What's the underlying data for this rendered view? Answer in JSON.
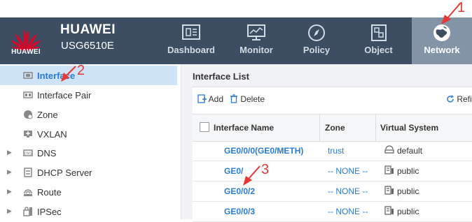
{
  "brand": {
    "logo_text": "HUAWEI",
    "name": "HUAWEI",
    "model": "USG6510E"
  },
  "nav": [
    {
      "label": "Dashboard",
      "icon": "dashboard-icon"
    },
    {
      "label": "Monitor",
      "icon": "monitor-icon"
    },
    {
      "label": "Policy",
      "icon": "policy-compass-icon"
    },
    {
      "label": "Object",
      "icon": "object-icon"
    },
    {
      "label": "Network",
      "icon": "network-globe-icon",
      "active": true
    }
  ],
  "sidebar": {
    "items": [
      {
        "label": "Interface",
        "icon": "interface-icon",
        "active": true
      },
      {
        "label": "Interface Pair",
        "icon": "interface-pair-icon"
      },
      {
        "label": "Zone",
        "icon": "zone-icon"
      },
      {
        "label": "VXLAN",
        "icon": "vxlan-icon"
      },
      {
        "label": "DNS",
        "icon": "dns-icon",
        "expandable": true
      },
      {
        "label": "DHCP Server",
        "icon": "dhcp-server-icon",
        "expandable": true
      },
      {
        "label": "Route",
        "icon": "route-icon",
        "expandable": true
      },
      {
        "label": "IPSec",
        "icon": "ipsec-icon",
        "expandable": true
      }
    ]
  },
  "main": {
    "title": "Interface List",
    "toolbar": {
      "add_label": "Add",
      "delete_label": "Delete",
      "refresh_label": "Refi"
    },
    "table": {
      "headers": {
        "name": "Interface Name",
        "zone": "Zone",
        "vsys": "Virtual System"
      },
      "rows": [
        {
          "name": "GE0/0/0(GE0/METH)",
          "zone": "trust",
          "vsys": "default"
        },
        {
          "name": "GE0/",
          "zone": "-- NONE --",
          "vsys": "public"
        },
        {
          "name": "GE0/0/2",
          "zone": "-- NONE --",
          "vsys": "public"
        },
        {
          "name": "GE0/0/3",
          "zone": "-- NONE --",
          "vsys": "public"
        }
      ]
    }
  },
  "annotations": {
    "one": "1",
    "two": "2",
    "three": "3"
  },
  "colors": {
    "header_bg": "#3d4e63",
    "active_tab": "#8494a7",
    "link": "#2a7bd1",
    "annotation": "#e53935",
    "brand_red": "#cf0a2c"
  }
}
